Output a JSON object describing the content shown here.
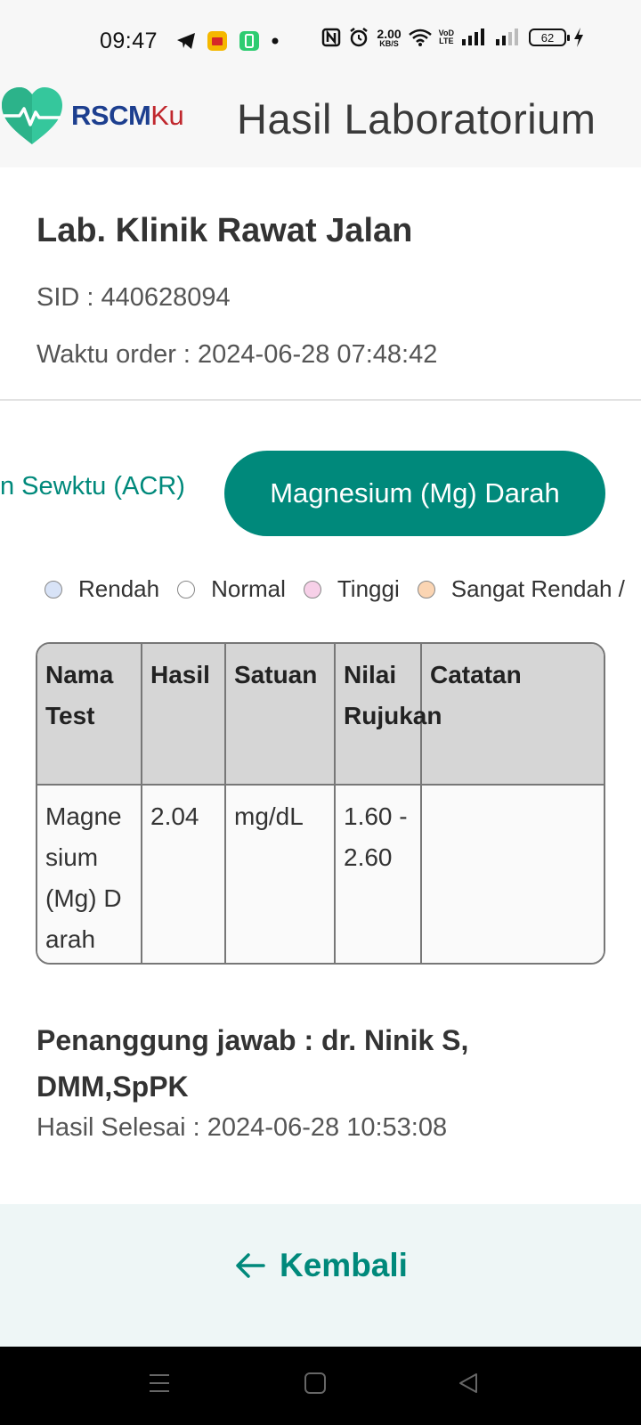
{
  "status_bar": {
    "time": "09:47",
    "net_speed_value": "2.00",
    "net_speed_unit": "KB/S",
    "volte_top": "VoD",
    "volte_bottom": "LTE",
    "battery": "62"
  },
  "header": {
    "logo_rscm": "RSCM",
    "logo_ku": "Ku",
    "title": "Hasil Laboratorium"
  },
  "lab": {
    "name": "Lab. Klinik Rawat Jalan",
    "sid": "SID : 440628094",
    "order_time": "Waktu order : 2024-06-28 07:48:42"
  },
  "tabs": [
    {
      "label": "n Sewktu (ACR)",
      "active": false
    },
    {
      "label": "Magnesium (Mg) Darah",
      "active": true
    }
  ],
  "legend": [
    {
      "label": "Rendah",
      "color": "#d8e3f7"
    },
    {
      "label": "Normal",
      "color": "#ffffff"
    },
    {
      "label": "Tinggi",
      "color": "#f7d0e8"
    },
    {
      "label": "Sangat Rendah /",
      "color": "#fbd5b3"
    }
  ],
  "table": {
    "headers": [
      "Nama Test",
      "Hasil",
      "Satuan",
      "Nilai Rujukan",
      "Catatan"
    ],
    "rows": [
      {
        "name": "Magnesium (Mg) Darah",
        "result": "2.04",
        "unit": "mg/dL",
        "reference": "1.60 - 2.60",
        "note": ""
      }
    ]
  },
  "responsible": "Penanggung jawab : dr. Ninik S, DMM,SpPK",
  "finished": "Hasil Selesai : 2024-06-28 10:53:08",
  "footer": {
    "back_label": "Kembali"
  },
  "colors": {
    "accent": "#00897b",
    "header_bg": "#f7f7f7",
    "footer_bg": "#eef6f6",
    "brand_blue": "#1d3f8f",
    "brand_red": "#c0272d"
  }
}
